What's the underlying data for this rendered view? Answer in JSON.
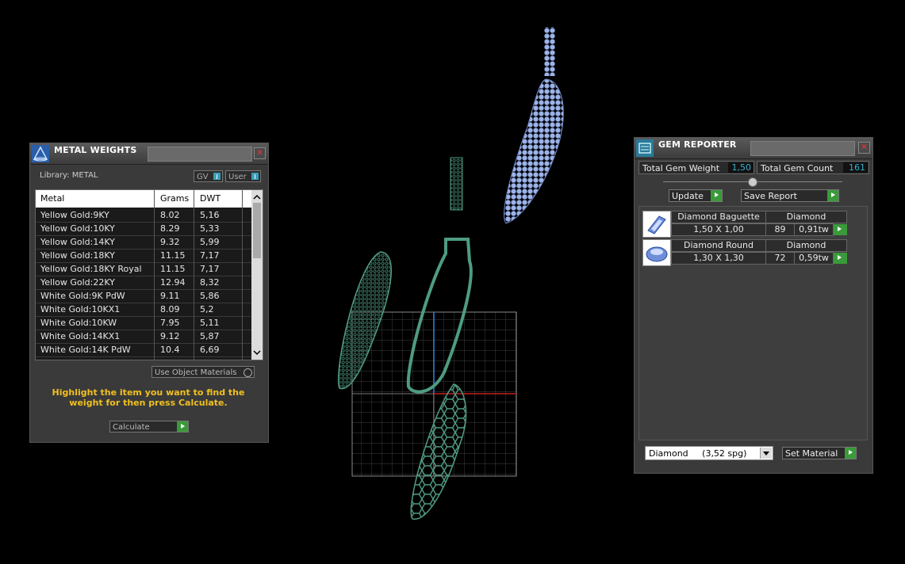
{
  "metal_weights": {
    "title": "METAL WEIGHTS",
    "close": "✕",
    "library_label": "Library: METAL",
    "toggle_gv": "GV",
    "toggle_user": "User",
    "columns": [
      "Metal",
      "Grams",
      "DWT"
    ],
    "rows": [
      [
        "Yellow Gold:9KY",
        "8.02",
        "5,16"
      ],
      [
        "Yellow Gold:10KY",
        "8.29",
        "5,33"
      ],
      [
        "Yellow Gold:14KY",
        "9.32",
        "5,99"
      ],
      [
        "Yellow Gold:18KY",
        "11.15",
        "7,17"
      ],
      [
        "Yellow Gold:18KY Royal",
        "11.15",
        "7,17"
      ],
      [
        "Yellow Gold:22KY",
        "12.94",
        "8,32"
      ],
      [
        "White Gold:9K PdW",
        "9.11",
        "5,86"
      ],
      [
        "White Gold:10KX1",
        "8.09",
        "5,2"
      ],
      [
        "White Gold:10KW",
        "7.95",
        "5,11"
      ],
      [
        "White Gold:14KX1",
        "9.12",
        "5,87"
      ],
      [
        "White Gold:14K PdW",
        "10.4",
        "6,69"
      ]
    ],
    "use_object_materials": "Use Object Materials",
    "instruction": "Highlight the item you want to find the weight for then press Calculate.",
    "calculate": "Calculate"
  },
  "gem_reporter": {
    "title": "GEM REPORTER",
    "close": "✕",
    "total_weight_label": "Total Gem Weight",
    "total_weight_value": "1,50",
    "total_count_label": "Total Gem Count",
    "total_count_value": "161",
    "update": "Update",
    "save_report": "Save Report",
    "gems": [
      {
        "name": "Diamond Baguette",
        "material": "Diamond",
        "size": "1,50 X 1,00",
        "count": "89",
        "weight": "0,91tw"
      },
      {
        "name": "Diamond Round",
        "material": "Diamond",
        "size": "1,30 X 1,30",
        "count": "72",
        "weight": "0,59tw"
      }
    ],
    "material_select": "Diamond     (3,52 spg)",
    "set_material": "Set Material"
  },
  "colors": {
    "viewport_bg": "#000000",
    "mesh_green": "#4f9c80",
    "gem_blue": "#9db4e6",
    "accent_yellow": "#f0c020",
    "value_cyan": "#3ab0d0"
  }
}
